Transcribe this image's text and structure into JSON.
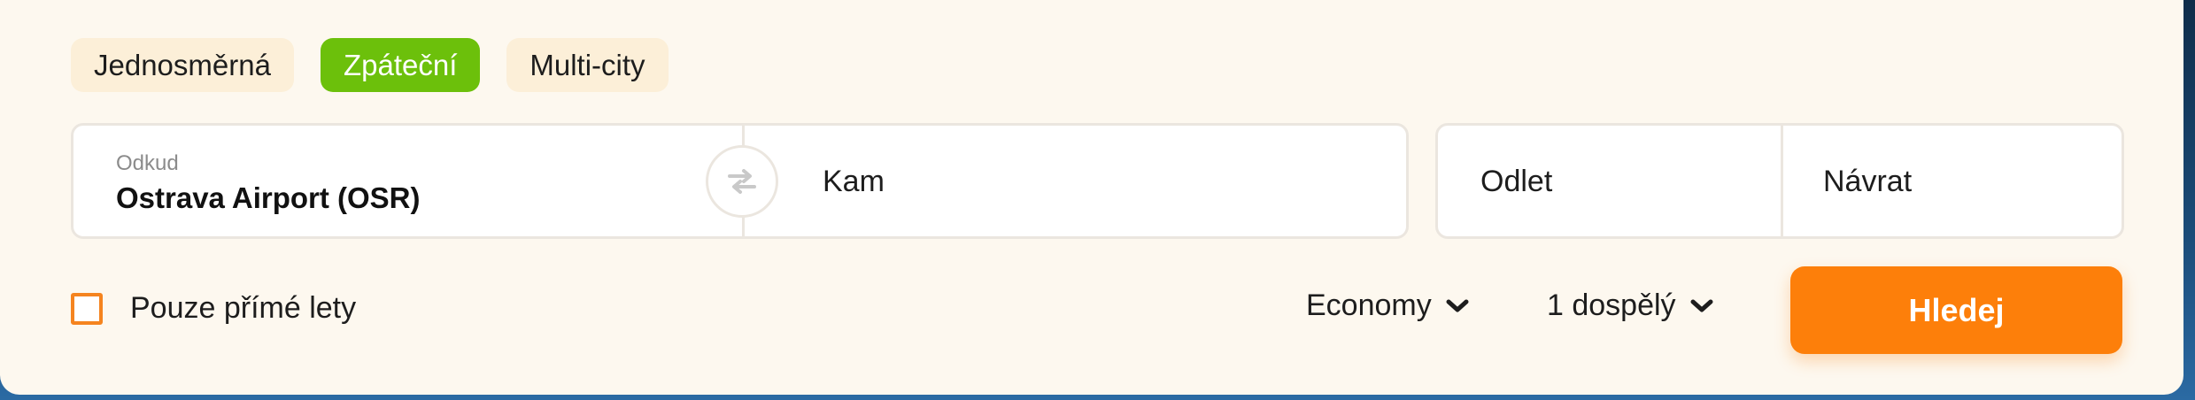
{
  "trip_tabs": [
    {
      "label": "Jednosměrná",
      "active": false
    },
    {
      "label": "Zpáteční",
      "active": true
    },
    {
      "label": "Multi-city",
      "active": false
    }
  ],
  "route": {
    "from_label": "Odkud",
    "from_value": "Ostrava Airport (OSR)",
    "to_placeholder": "Kam",
    "swap_icon": "swap-arrows-icon"
  },
  "dates": {
    "depart_placeholder": "Odlet",
    "return_placeholder": "Návrat"
  },
  "options": {
    "direct_only_label": "Pouze přímé lety",
    "direct_only_checked": false,
    "cabin_class": "Economy",
    "passengers": "1 dospělý",
    "chevron_icon": "chevron-down-icon"
  },
  "search_button": {
    "label": "Hledej"
  },
  "colors": {
    "accent_green": "#6cc00b",
    "accent_orange": "#fd7f0a",
    "panel_bg": "#fdf8ef",
    "tab_bg": "#fcefd8"
  }
}
